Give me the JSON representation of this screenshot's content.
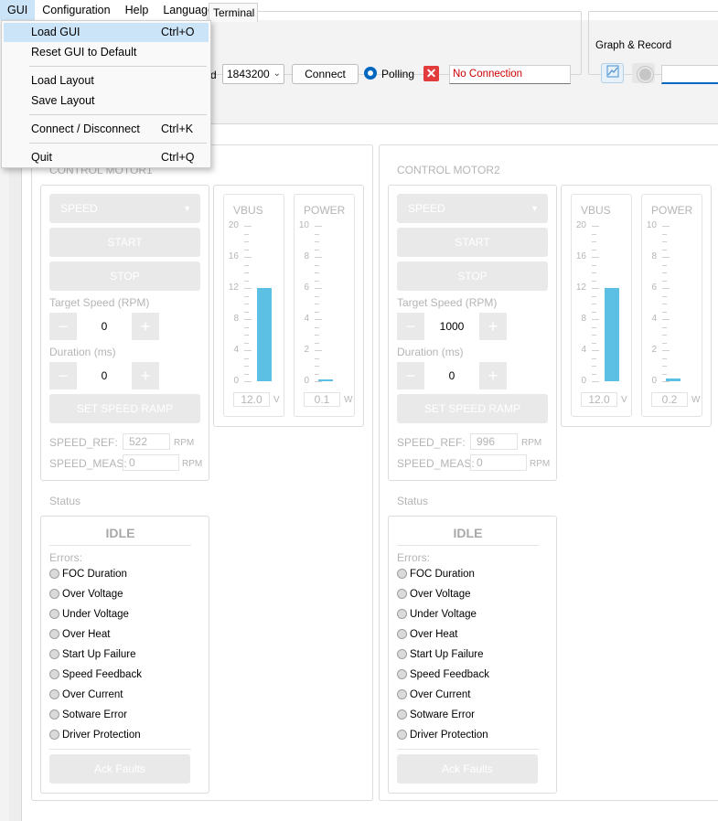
{
  "menubar": {
    "items": [
      "GUI",
      "Configuration",
      "Help",
      "Language"
    ]
  },
  "gui_menu": {
    "items": [
      {
        "label": "Load GUI",
        "shortcut": "Ctrl+O"
      },
      {
        "label": "Reset GUI to Default",
        "shortcut": ""
      },
      {
        "label": "Load Layout",
        "shortcut": ""
      },
      {
        "label": "Save Layout",
        "shortcut": ""
      },
      {
        "label": "Connect / Disconnect",
        "shortcut": "Ctrl+K"
      },
      {
        "label": "Quit",
        "shortcut": "Ctrl+Q"
      }
    ]
  },
  "toolbar": {
    "speed_label_fragment": "d",
    "baud_rate": "1843200",
    "connect_label": "Connect",
    "polling_label": "Polling",
    "connection_status": "No Connection",
    "connection_status_color": "#cc0000",
    "graph_title": "Graph & Record"
  },
  "tabs": {
    "terminal": "Terminal"
  },
  "motors": [
    {
      "title": "CONTROL MOTOR1",
      "mode": "SPEED",
      "start": "START",
      "stop": "STOP",
      "target_speed_label": "Target Speed (RPM)",
      "target_speed": "0",
      "duration_label": "Duration (ms)",
      "duration": "0",
      "ramp_label": "SET SPEED RAMP",
      "speed_ref_label": "SPEED_REF:",
      "speed_ref": "522",
      "speed_meas_label": "SPEED_MEAS:",
      "speed_meas": "0",
      "rpm_unit": "RPM",
      "vbus": {
        "label": "VBUS",
        "ticks": [
          "20",
          "16",
          "12",
          "8",
          "4",
          "0"
        ],
        "max": 20,
        "value_fraction": 0.6,
        "readout": "12.0",
        "unit": "V"
      },
      "power": {
        "label": "POWER",
        "ticks": [
          "10",
          "8",
          "6",
          "4",
          "2",
          "0"
        ],
        "max": 10,
        "value_fraction": 0.01,
        "readout": "0.1",
        "unit": "W"
      },
      "status_title": "Status",
      "state": "IDLE",
      "errors_label": "Errors:",
      "errors": [
        "FOC Duration",
        "Over Voltage",
        "Under Voltage",
        "Over Heat",
        "Start Up Failure",
        "Speed Feedback",
        "Over Current",
        "Sotware Error",
        "Driver Protection"
      ],
      "ack": "Ack Faults"
    },
    {
      "title": "CONTROL MOTOR2",
      "mode": "SPEED",
      "start": "START",
      "stop": "STOP",
      "target_speed_label": "Target Speed (RPM)",
      "target_speed": "1000",
      "duration_label": "Duration (ms)",
      "duration": "0",
      "ramp_label": "SET SPEED RAMP",
      "speed_ref_label": "SPEED_REF:",
      "speed_ref": "996",
      "speed_meas_label": "SPEED_MEAS:",
      "speed_meas": "0",
      "rpm_unit": "RPM",
      "vbus": {
        "label": "VBUS",
        "ticks": [
          "20",
          "16",
          "12",
          "8",
          "4",
          "0"
        ],
        "max": 20,
        "value_fraction": 0.6,
        "readout": "12.0",
        "unit": "V"
      },
      "power": {
        "label": "POWER",
        "ticks": [
          "10",
          "8",
          "6",
          "4",
          "2",
          "0"
        ],
        "max": 10,
        "value_fraction": 0.02,
        "readout": "0.2",
        "unit": "W"
      },
      "status_title": "Status",
      "state": "IDLE",
      "errors_label": "Errors:",
      "errors": [
        "FOC Duration",
        "Over Voltage",
        "Under Voltage",
        "Over Heat",
        "Start Up Failure",
        "Speed Feedback",
        "Over Current",
        "Sotware Error",
        "Driver Protection"
      ],
      "ack": "Ack Faults"
    }
  ]
}
